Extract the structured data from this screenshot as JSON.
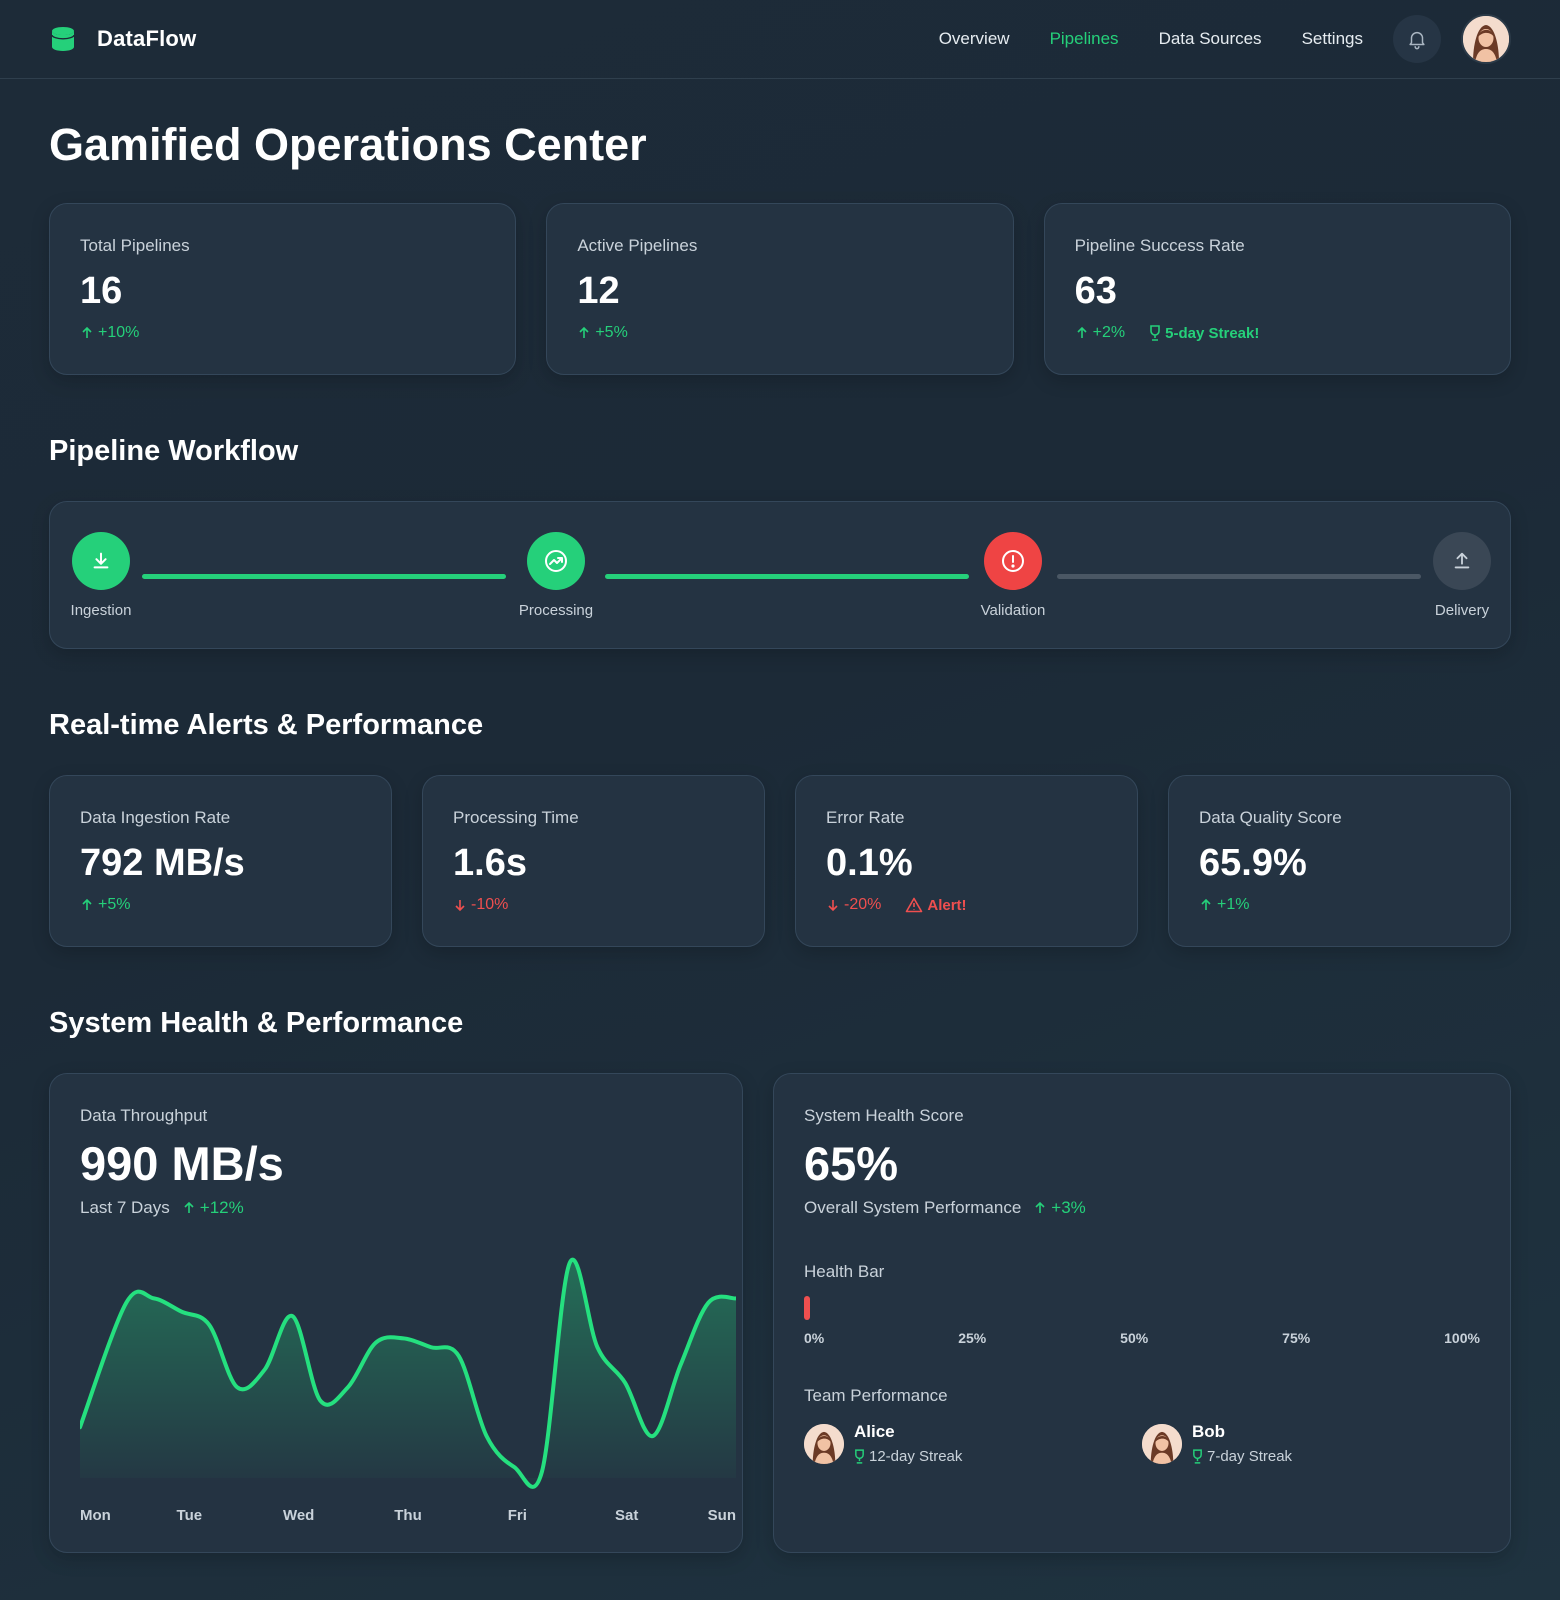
{
  "app": {
    "name": "DataFlow",
    "icon": "database-icon"
  },
  "nav": {
    "items": [
      {
        "label": "Overview",
        "active": false
      },
      {
        "label": "Pipelines",
        "active": true
      },
      {
        "label": "Data Sources",
        "active": false
      },
      {
        "label": "Settings",
        "active": false
      }
    ],
    "bell_icon": "bell-icon"
  },
  "page_title": "Gamified Operations Center",
  "summary_cards": [
    {
      "label": "Total Pipelines",
      "value": "16",
      "change": "+10%",
      "direction": "up"
    },
    {
      "label": "Active Pipelines",
      "value": "12",
      "change": "+5%",
      "direction": "up"
    },
    {
      "label": "Pipeline Success Rate",
      "value": "63",
      "change": "+2%",
      "direction": "up",
      "badge": "5-day Streak!"
    }
  ],
  "workflow": {
    "title": "Pipeline Workflow",
    "steps": [
      {
        "label": "Ingestion",
        "status": "done",
        "icon": "download-icon"
      },
      {
        "label": "Processing",
        "status": "done",
        "icon": "trend-icon"
      },
      {
        "label": "Validation",
        "status": "error",
        "icon": "alert-circle-icon"
      },
      {
        "label": "Delivery",
        "status": "pending",
        "icon": "upload-icon"
      }
    ]
  },
  "alerts": {
    "title": "Real-time Alerts & Performance",
    "cards": [
      {
        "label": "Data Ingestion Rate",
        "value": "792 MB/s",
        "change": "+5%",
        "direction": "up"
      },
      {
        "label": "Processing Time",
        "value": "1.6s",
        "change": "-10%",
        "direction": "down"
      },
      {
        "label": "Error Rate",
        "value": "0.1%",
        "change": "-20%",
        "direction": "down",
        "alert": "Alert!"
      },
      {
        "label": "Data Quality Score",
        "value": "65.9%",
        "change": "+1%",
        "direction": "up"
      }
    ]
  },
  "health": {
    "title": "System Health & Performance",
    "throughput": {
      "label": "Data Throughput",
      "value": "990 MB/s",
      "period": "Last 7 Days",
      "change": "+12%"
    },
    "system": {
      "label": "System Health Score",
      "value": "65%",
      "sub": "Overall System Performance",
      "change": "+3%",
      "bar_label": "Health Bar",
      "scale": [
        "0%",
        "25%",
        "50%",
        "75%",
        "100%"
      ],
      "team_label": "Team Performance",
      "team": [
        {
          "name": "Alice",
          "streak": "12-day Streak"
        },
        {
          "name": "Bob",
          "streak": "7-day Streak"
        }
      ]
    }
  },
  "colors": {
    "accent": "#25d07a",
    "danger": "#ef4f4f",
    "card": "#243342",
    "pending": "#3a4755"
  },
  "chart_data": {
    "type": "area",
    "categories": [
      "Mon",
      "Tue",
      "Wed",
      "Thu",
      "Fri",
      "Sat",
      "Sun"
    ],
    "x": [
      0,
      0.5,
      0.8,
      1.1,
      1.4,
      1.7,
      2.0,
      2.3,
      2.6,
      2.9,
      3.2,
      3.5,
      3.8,
      4.1,
      4.4,
      4.7,
      5.0,
      5.3,
      5.6,
      5.9,
      6.2,
      6.5,
      6.8,
      7.1
    ],
    "values": [
      22,
      78,
      80,
      74,
      68,
      40,
      48,
      72,
      34,
      40,
      60,
      62,
      58,
      54,
      18,
      4,
      2,
      96,
      58,
      42,
      18,
      50,
      78,
      80
    ],
    "title": "",
    "xlabel": "",
    "ylabel": "",
    "grid": false,
    "legend": false
  }
}
